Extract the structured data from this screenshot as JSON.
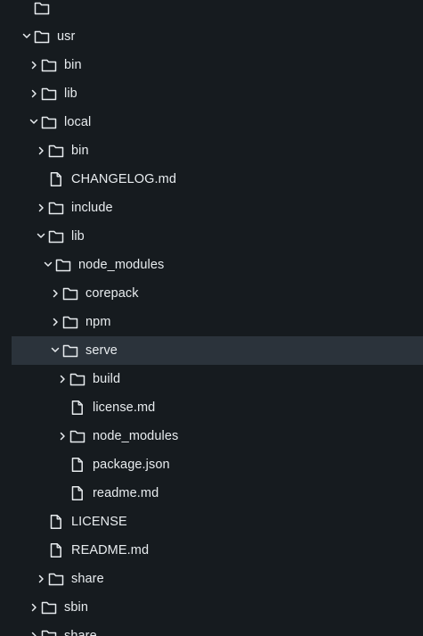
{
  "tree": [
    {
      "label": "",
      "type": "folder",
      "depth": 0,
      "expanded": true,
      "selected": false,
      "chevron": "none"
    },
    {
      "label": "usr",
      "type": "folder",
      "depth": 0,
      "expanded": true,
      "selected": false,
      "chevron": "chevron-down-icon"
    },
    {
      "label": "bin",
      "type": "folder",
      "depth": 1,
      "expanded": false,
      "selected": false,
      "chevron": "chevron-right-icon"
    },
    {
      "label": "lib",
      "type": "folder",
      "depth": 1,
      "expanded": false,
      "selected": false,
      "chevron": "chevron-right-icon"
    },
    {
      "label": "local",
      "type": "folder",
      "depth": 1,
      "expanded": true,
      "selected": false,
      "chevron": "chevron-down-icon"
    },
    {
      "label": "bin",
      "type": "folder",
      "depth": 2,
      "expanded": false,
      "selected": false,
      "chevron": "chevron-right-icon"
    },
    {
      "label": "CHANGELOG.md",
      "type": "file",
      "depth": 2,
      "selected": false
    },
    {
      "label": "include",
      "type": "folder",
      "depth": 2,
      "expanded": false,
      "selected": false,
      "chevron": "chevron-right-icon"
    },
    {
      "label": "lib",
      "type": "folder",
      "depth": 2,
      "expanded": true,
      "selected": false,
      "chevron": "chevron-down-icon"
    },
    {
      "label": "node_modules",
      "type": "folder",
      "depth": 3,
      "expanded": true,
      "selected": false,
      "chevron": "chevron-down-icon"
    },
    {
      "label": "corepack",
      "type": "folder",
      "depth": 4,
      "expanded": false,
      "selected": false,
      "chevron": "chevron-right-icon"
    },
    {
      "label": "npm",
      "type": "folder",
      "depth": 4,
      "expanded": false,
      "selected": false,
      "chevron": "chevron-right-icon"
    },
    {
      "label": "serve",
      "type": "folder",
      "depth": 4,
      "expanded": true,
      "selected": true,
      "chevron": "chevron-down-icon"
    },
    {
      "label": "build",
      "type": "folder",
      "depth": 5,
      "expanded": false,
      "selected": false,
      "chevron": "chevron-right-icon"
    },
    {
      "label": "license.md",
      "type": "file",
      "depth": 5,
      "selected": false
    },
    {
      "label": "node_modules",
      "type": "folder",
      "depth": 5,
      "expanded": false,
      "selected": false,
      "chevron": "chevron-right-icon"
    },
    {
      "label": "package.json",
      "type": "file",
      "depth": 5,
      "selected": false
    },
    {
      "label": "readme.md",
      "type": "file",
      "depth": 5,
      "selected": false
    },
    {
      "label": "LICENSE",
      "type": "file",
      "depth": 2,
      "selected": false
    },
    {
      "label": "README.md",
      "type": "file",
      "depth": 2,
      "selected": false
    },
    {
      "label": "share",
      "type": "folder",
      "depth": 2,
      "expanded": false,
      "selected": false,
      "chevron": "chevron-right-icon"
    },
    {
      "label": "sbin",
      "type": "folder",
      "depth": 1,
      "expanded": false,
      "selected": false,
      "chevron": "chevron-right-icon"
    },
    {
      "label": "share",
      "type": "folder",
      "depth": 1,
      "expanded": false,
      "selected": false,
      "chevron": "chevron-right-icon"
    }
  ],
  "colors": {
    "background": "#161b1f",
    "selected_row": "#2b333b",
    "text": "#e8ecef",
    "icon": "#e8ecef"
  },
  "icons": {
    "folder": "folder-icon",
    "file": "file-icon",
    "expand": "chevron-right-icon",
    "collapse": "chevron-down-icon"
  }
}
